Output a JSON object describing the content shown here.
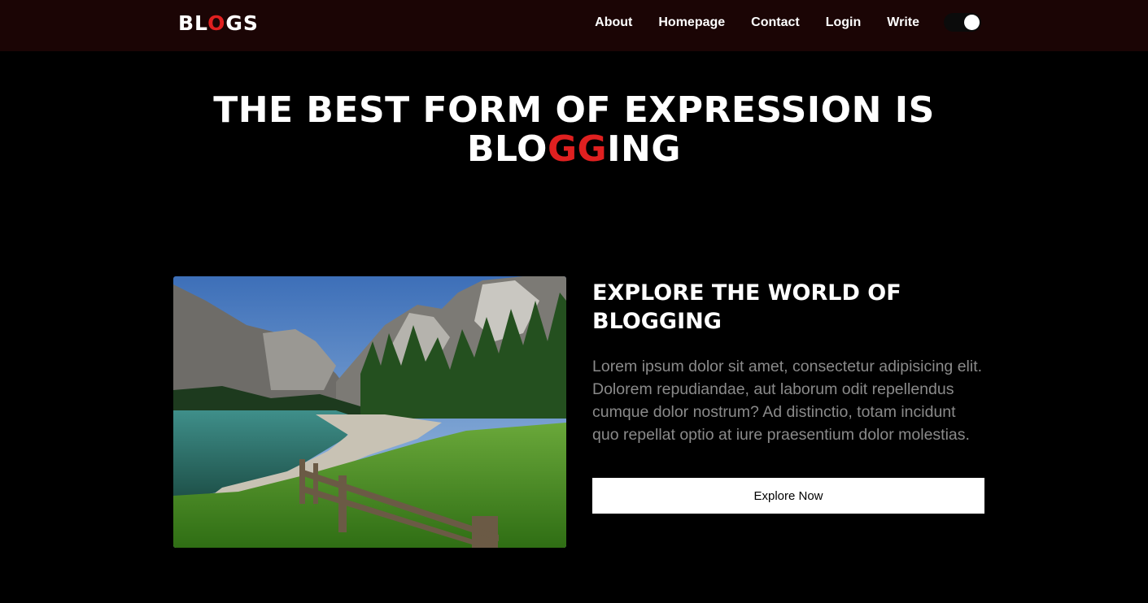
{
  "navbar": {
    "logo_pre": "BL",
    "logo_accent": "O",
    "logo_post": "GS",
    "links": [
      "About",
      "Homepage",
      "Contact",
      "Login",
      "Write"
    ],
    "theme_toggle_on": true
  },
  "hero": {
    "line1": "THE BEST FORM OF EXPRESSION IS",
    "word_pre": "BLO",
    "word_accent": "GG",
    "word_post": "ING"
  },
  "card": {
    "image_icon": "landscape-photo",
    "title": "EXPLORE THE WORLD OF BLOGGING",
    "description": "Lorem ipsum dolor sit amet, consectetur adipisicing elit. Dolorem repudiandae, aut laborum odit repellendus cumque dolor nostrum? Ad distinctio, totam incidunt quo repellat optio at iure praesentium dolor molestias.",
    "button_label": "Explore Now"
  },
  "colors": {
    "accent": "#e02020",
    "navbar_bg": "#1b0505",
    "page_bg": "#000000",
    "muted_text": "#8a8a8a"
  }
}
